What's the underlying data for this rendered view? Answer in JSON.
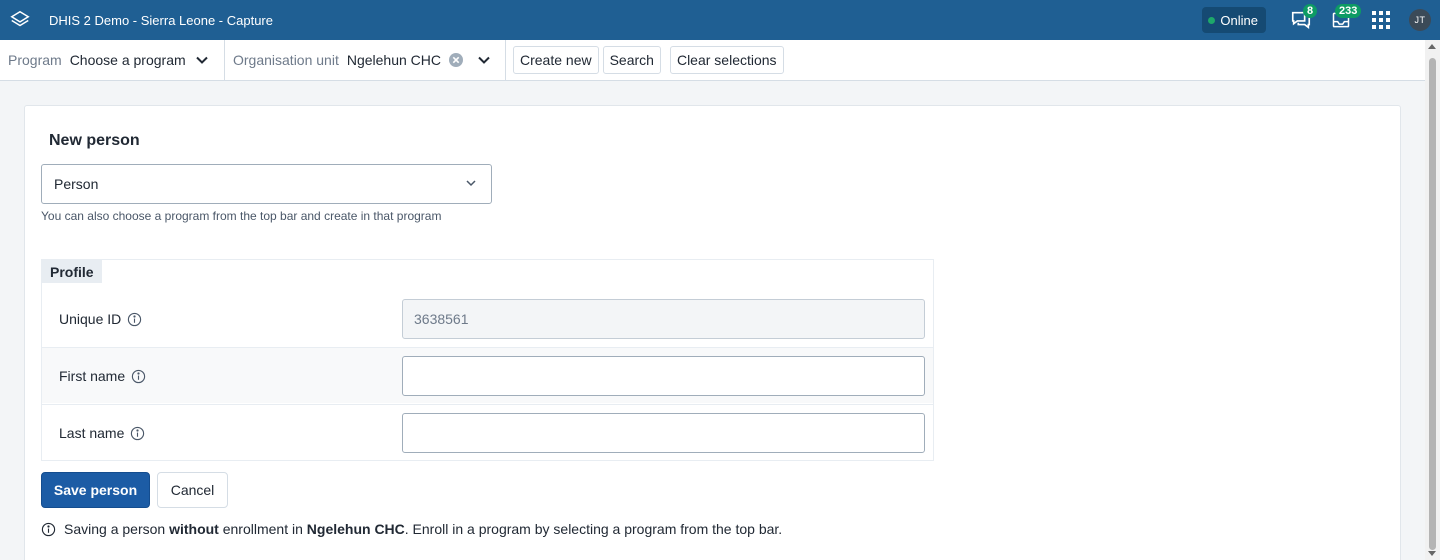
{
  "header": {
    "app_title": "DHIS 2 Demo - Sierra Leone - Capture",
    "online_label": "Online",
    "messages_count": "8",
    "interpretations_count": "233",
    "user_initials": "JT"
  },
  "topbar": {
    "program_label": "Program",
    "program_value": "Choose a program",
    "org_unit_label": "Organisation unit",
    "org_unit_value": "Ngelehun CHC",
    "create_new": "Create new",
    "search": "Search",
    "clear_selections": "Clear selections"
  },
  "form": {
    "title": "New person",
    "type_value": "Person",
    "help_text": "You can also choose a program from the top bar and create in that program",
    "section_title": "Profile",
    "fields": [
      {
        "label": "Unique ID",
        "value": "3638561"
      },
      {
        "label": "First name",
        "value": ""
      },
      {
        "label": "Last name",
        "value": ""
      }
    ],
    "save_label": "Save person",
    "cancel_label": "Cancel",
    "notice": {
      "part1": "Saving a person ",
      "bold1": "without",
      "part2": " enrollment in ",
      "bold2": "Ngelehun CHC",
      "part3": ". Enroll in a program by selecting a program from the top bar."
    }
  },
  "colors": {
    "header_bg": "#1f5f93",
    "primary_button": "#1c5ca5",
    "online_dot": "#1ea86a",
    "badge": "#0d9b64"
  }
}
